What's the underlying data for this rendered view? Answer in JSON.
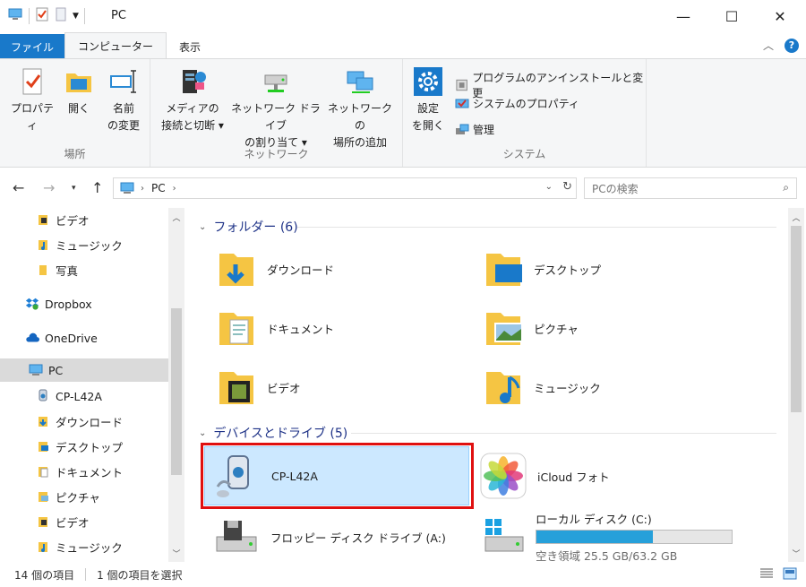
{
  "window": {
    "title": "PC"
  },
  "ribbon_tabs": {
    "file": "ファイル",
    "computer": "コンピューター",
    "view": "表示"
  },
  "ribbon": {
    "groups": {
      "location": "場所",
      "network": "ネットワーク",
      "system": "システム"
    },
    "location": {
      "properties": "プロパティ",
      "open": "開く",
      "rename_line1": "名前",
      "rename_line2": "の変更"
    },
    "network": {
      "media_line1": "メディアの",
      "media_line2": "接続と切断 ▾",
      "map_line1": "ネットワーク ドライブ",
      "map_line2": "の割り当て ▾",
      "add_line1": "ネットワークの",
      "add_line2": "場所の追加"
    },
    "system": {
      "settings_line1": "設定",
      "settings_line2": "を開く",
      "uninstall": "プログラムのアンインストールと変更",
      "sysprops": "システムのプロパティ",
      "manage": "管理"
    }
  },
  "address": {
    "path": "PC",
    "search_placeholder": "PCの検索"
  },
  "nav": {
    "items": [
      {
        "label": "ビデオ"
      },
      {
        "label": "ミュージック"
      },
      {
        "label": "写真"
      },
      {
        "label": "Dropbox"
      },
      {
        "label": "OneDrive"
      },
      {
        "label": "PC"
      },
      {
        "label": "CP-L42A"
      },
      {
        "label": "ダウンロード"
      },
      {
        "label": "デスクトップ"
      },
      {
        "label": "ドキュメント"
      },
      {
        "label": "ピクチャ"
      },
      {
        "label": "ビデオ"
      },
      {
        "label": "ミュージック"
      }
    ]
  },
  "content": {
    "folders_header": "フォルダー (6)",
    "folders": [
      {
        "label": "ダウンロード"
      },
      {
        "label": "デスクトップ"
      },
      {
        "label": "ドキュメント"
      },
      {
        "label": "ピクチャ"
      },
      {
        "label": "ビデオ"
      },
      {
        "label": "ミュージック"
      }
    ],
    "devices_header": "デバイスとドライブ (5)",
    "devices": [
      {
        "label": "CP-L42A"
      },
      {
        "label": "iCloud フォト"
      },
      {
        "label": "フロッピー ディスク ドライブ (A:)"
      },
      {
        "label": "ローカル ディスク (C:)",
        "free": "空き領域 25.5 GB/63.2 GB",
        "used_fraction": 0.596
      }
    ]
  },
  "status": {
    "count": "14 個の項目",
    "selected": "1 個の項目を選択"
  },
  "colors": {
    "accent": "#1979ca",
    "selection": "#cce8ff",
    "highlight_box": "#e01010"
  }
}
